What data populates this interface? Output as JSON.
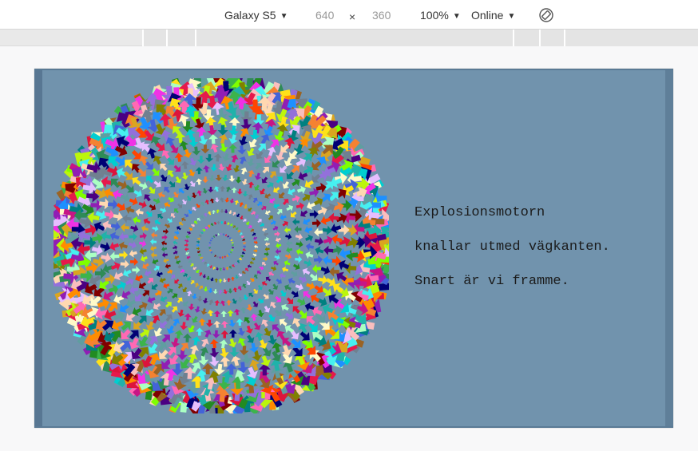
{
  "toolbar": {
    "device_name": "Galaxy S5",
    "width": "640",
    "times": "×",
    "height": "360",
    "zoom": "100%",
    "network": "Online",
    "rotate_icon": "rotate-icon"
  },
  "content": {
    "lines": [
      "Explosionsmotorn",
      "knallar utmed vägkanten.",
      "Snart är vi framme."
    ]
  },
  "colors": {
    "screen_bg": "#7193ad",
    "device_frame": "#5a7a95"
  }
}
